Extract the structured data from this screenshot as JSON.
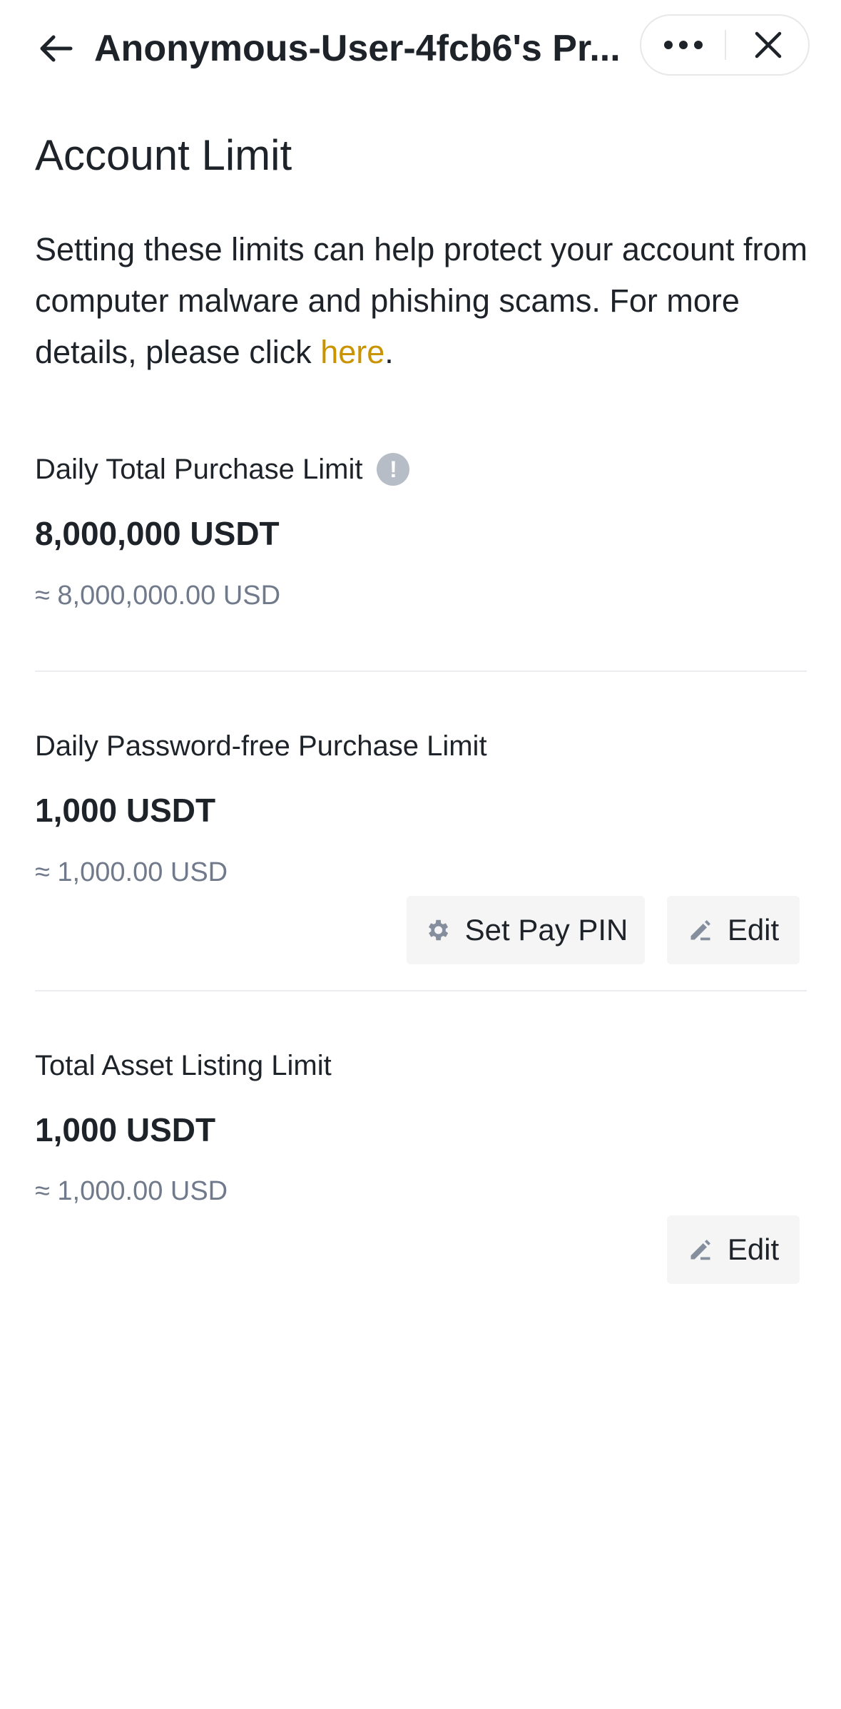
{
  "header": {
    "title": "Anonymous-User-4fcb6's Pr...",
    "back_icon": "arrow-left-icon",
    "more_icon": "more-horizontal-icon",
    "close_icon": "close-icon"
  },
  "main": {
    "heading": "Account Limit",
    "intro_text": "Setting these limits can help protect your account from computer malware and phishing scams. For more details, please click ",
    "intro_link": "here",
    "intro_end": ".",
    "link_color": "#c99400",
    "sections": [
      {
        "label": "Daily Total Purchase Limit",
        "amount": "8,000,000 USDT",
        "approx": "≈ 8,000,000.00 USD",
        "has_info_icon": true
      },
      {
        "label": "Daily Password-free Purchase Limit",
        "amount": "1,000 USDT",
        "approx": "≈ 1,000.00 USD",
        "buttons": {
          "set_pin": "Set Pay PIN",
          "edit": "Edit"
        }
      },
      {
        "label": "Total Asset Listing Limit",
        "amount": "1,000 USDT",
        "approx": "≈ 1,000.00 USD",
        "buttons": {
          "edit": "Edit"
        }
      }
    ]
  }
}
